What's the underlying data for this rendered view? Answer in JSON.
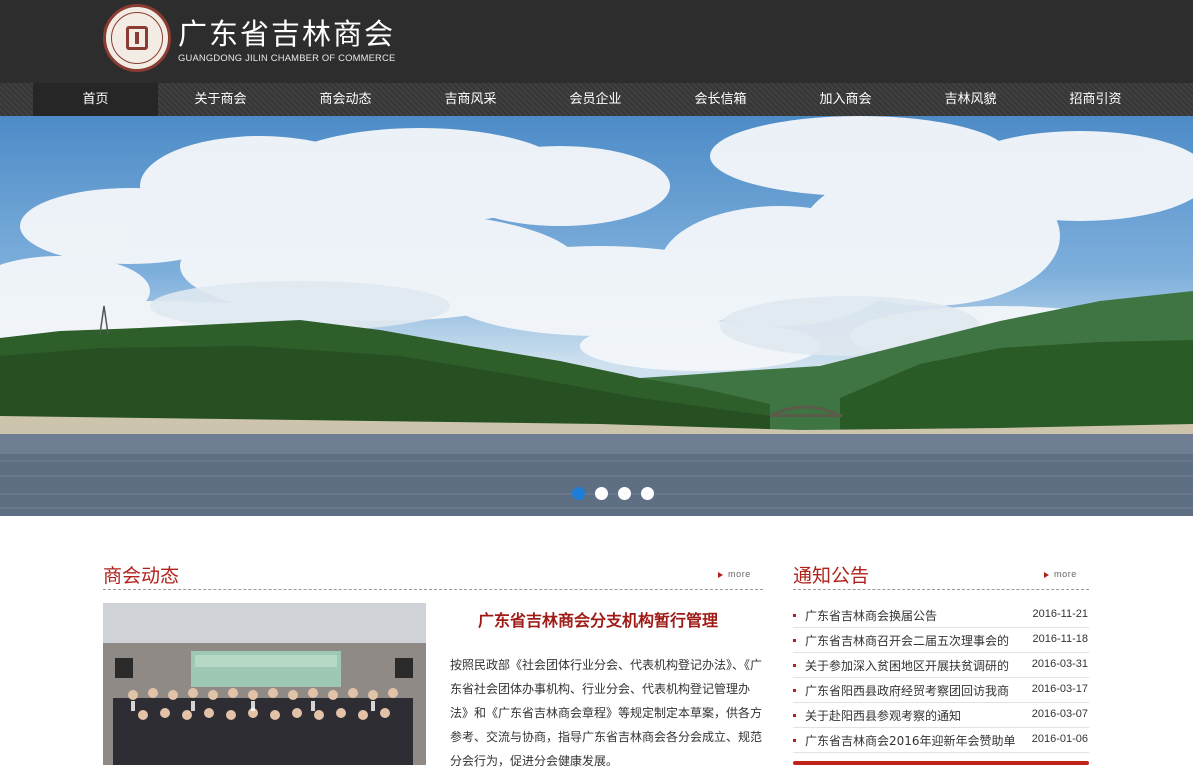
{
  "header": {
    "title_cn": "广东省吉林商会",
    "title_en": "GUANGDONG JILIN CHAMBER OF COMMERCE",
    "logo_icon": "seal-logo-icon"
  },
  "nav": {
    "items": [
      {
        "label": "首页",
        "active": true
      },
      {
        "label": "关于商会",
        "active": false
      },
      {
        "label": "商会动态",
        "active": false
      },
      {
        "label": "吉商风采",
        "active": false
      },
      {
        "label": "会员企业",
        "active": false
      },
      {
        "label": "会长信箱",
        "active": false
      },
      {
        "label": "加入商会",
        "active": false
      },
      {
        "label": "吉林风貌",
        "active": false
      },
      {
        "label": "招商引资",
        "active": false
      }
    ]
  },
  "banner": {
    "slide_count": 4,
    "active_slide": 1
  },
  "news": {
    "section_title": "商会动态",
    "more_label": "more",
    "headline": "广东省吉林商会分支机构暂行管理",
    "body": "按照民政部《社会团体行业分会、代表机构登记办法》、《广东省社会团体办事机构、行业分会、代表机构登记管理办法》和《广东省吉林商会章程》等规定制定本草案，供各方参考、交流与协商，指导广东省吉林商会各分会成立、规范分会行为，促进分会健康发展。",
    "photo_banner_text": "东北商会阳西考察活动座谈会"
  },
  "notices": {
    "section_title": "通知公告",
    "more_label": "more",
    "items": [
      {
        "title": "广东省吉林商会换届公告",
        "date": "2016-11-21"
      },
      {
        "title": "广东省吉林商召开会二届五次理事会的",
        "date": "2016-11-18"
      },
      {
        "title": "关于参加深入贫困地区开展扶贫调研的",
        "date": "2016-03-31"
      },
      {
        "title": "广东省阳西县政府经贸考察团回访我商",
        "date": "2016-03-17"
      },
      {
        "title": "关于赴阳西县参观考察的通知",
        "date": "2016-03-07"
      },
      {
        "title": "广东省吉林商会2016年迎新年会赞助单",
        "date": "2016-01-06"
      }
    ]
  },
  "colors": {
    "header_bg": "#2d2d2d",
    "accent_red": "#b0221c",
    "active_dot": "#1d7fd6"
  }
}
